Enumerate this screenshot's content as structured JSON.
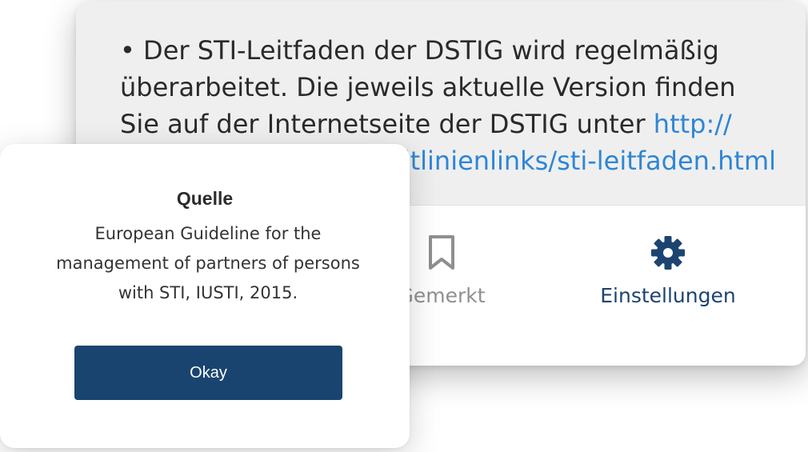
{
  "background": {
    "text_line1": "• Der STI-Leitfaden der DSTIG wird regelmäßig",
    "text_line2": "überarbeitet. Die jeweils aktuelle Version finden",
    "text_line3_plain": "Sie auf der Internetseite der DSTIG unter ",
    "text_line3_link": "http://",
    "text_line4_link": "www.dstig.de/literaturleitlinienlinks/sti-leitfaden.html",
    "link_color": "#2d86d6"
  },
  "tab_bar": {
    "bookmark_label": "Gemerkt",
    "bookmark_icon": "bookmark-icon",
    "settings_label": "Einstellungen",
    "settings_icon": "gear-icon",
    "active_color": "#1d4470",
    "inactive_color": "#8f8f8f"
  },
  "dialog": {
    "title": "Quelle",
    "body_line1": "European Guideline for the",
    "body_line2": "management of partners of persons",
    "body_line3": "with STI, IUSTI, 2015.",
    "okay_label": "Okay",
    "button_color": "#1a4470"
  }
}
